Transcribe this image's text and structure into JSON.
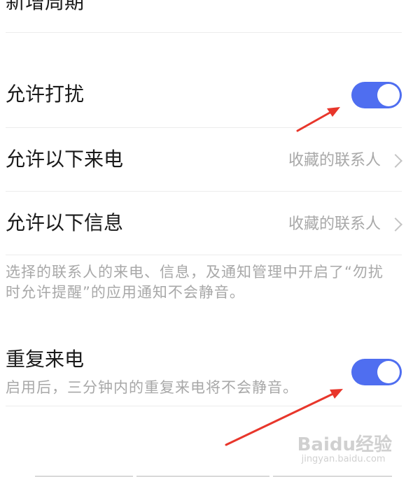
{
  "top_item": {
    "label": "新增周期"
  },
  "dnd_permission": {
    "label": "允许打扰",
    "toggle_on": true,
    "accent_color": "#4f6ef0"
  },
  "allow_calls": {
    "label": "允许以下来电",
    "value": "收藏的联系人"
  },
  "allow_messages": {
    "label": "允许以下信息",
    "value": "收藏的联系人"
  },
  "hint_text": "选择的联系人的来电、信息，及通知管理中开启了“勿扰时允许提醒”的应用通知不会静音。",
  "repeat_calls": {
    "label": "重复来电",
    "description": "启用后，三分钟内的重复来电将不会静音。",
    "toggle_on": true
  },
  "annotation_color": "#e8362b",
  "watermark": {
    "brand": "Baidu经验",
    "url": "jingyan.baidu.com"
  }
}
